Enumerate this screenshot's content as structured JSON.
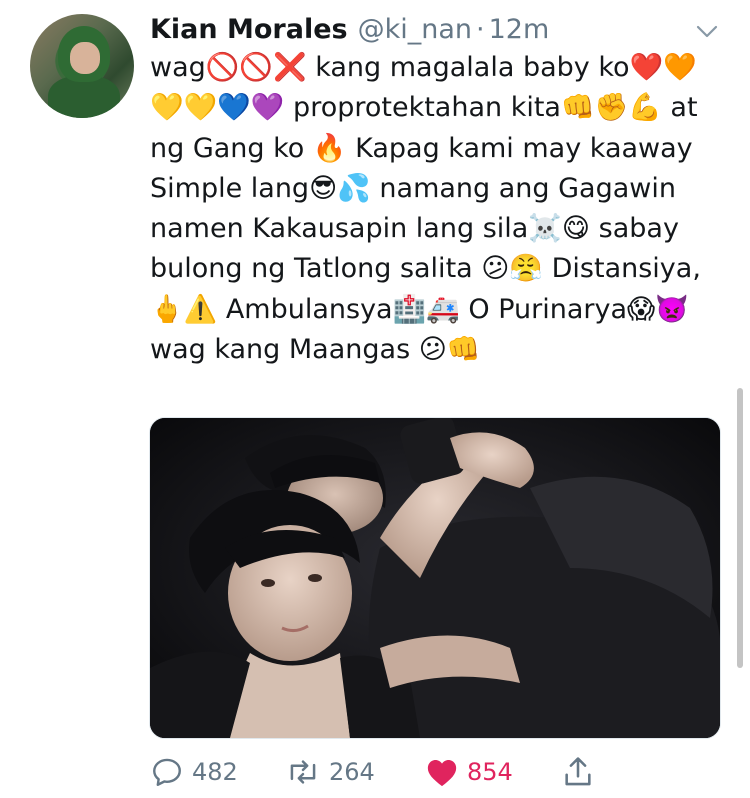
{
  "tweet": {
    "author": {
      "name": "Kian Morales",
      "handle": "@ki_nan",
      "separator": "·",
      "time": "12m"
    },
    "text": "wag🚫🚫❌ kang magalala baby ko❤️🧡💛💛💙💜 proprotektahan kita👊✊💪 at ng Gang ko 🔥 Kapag kami may kaaway Simple lang😎💦 namang ang Gagawin namen Kakausapin lang sila☠️😋 sabay bulong ng Tatlong salita 😕😤 Distansiya,🖕⚠️ Ambulansya🏥🚑 O Purinarya😱👿 wag kang Maangas 😕👊",
    "media": {
      "alt_icon": "photo-two-people"
    },
    "actions": {
      "replies": "482",
      "retweets": "264",
      "likes": "854"
    }
  },
  "colors": {
    "text": "#14171a",
    "secondary": "#657786",
    "like": "#e0245e",
    "border": "#e1e8ed"
  }
}
